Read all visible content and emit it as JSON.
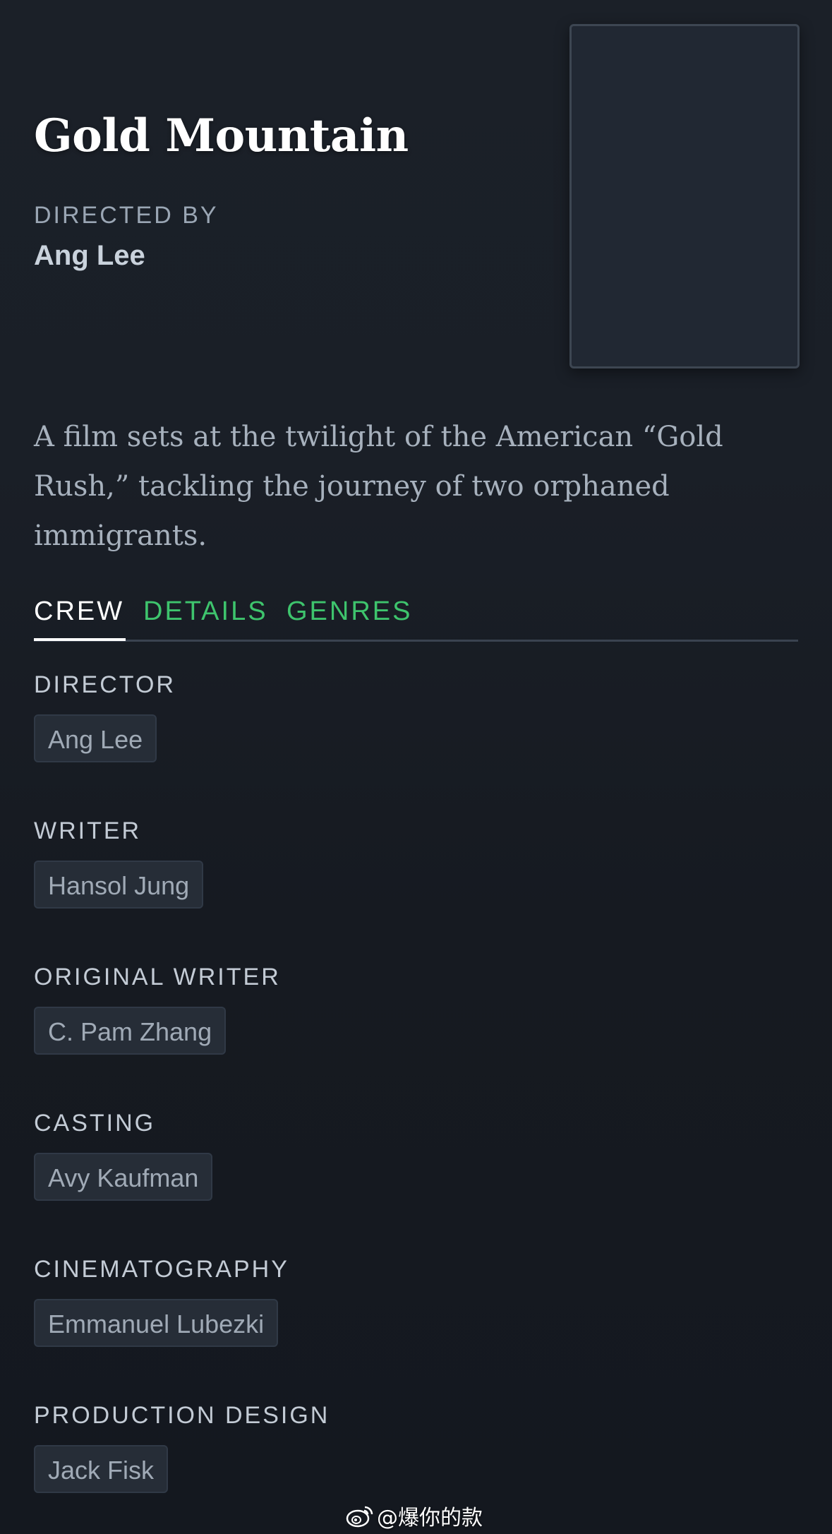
{
  "film": {
    "title": "Gold Mountain",
    "directed_by_label": "DIRECTED BY",
    "director": "Ang Lee",
    "synopsis": "A film sets at the twilight of the American “Gold Rush,” tackling the journey of two orphaned immigrants."
  },
  "tabs": [
    {
      "label": "CREW",
      "active": true
    },
    {
      "label": "DETAILS",
      "active": false
    },
    {
      "label": "GENRES",
      "active": false
    }
  ],
  "crew": [
    {
      "role": "DIRECTOR",
      "name": "Ang Lee"
    },
    {
      "role": "WRITER",
      "name": "Hansol Jung"
    },
    {
      "role": "ORIGINAL WRITER",
      "name": "C. Pam Zhang"
    },
    {
      "role": "CASTING",
      "name": "Avy Kaufman"
    },
    {
      "role": "CINEMATOGRAPHY",
      "name": "Emmanuel Lubezki"
    },
    {
      "role": "PRODUCTION DESIGN",
      "name": "Jack Fisk"
    }
  ],
  "watermark": {
    "text": "@爆你的款",
    "icon": "weibo-icon"
  },
  "colors": {
    "accent_green": "#3ec46d",
    "background": "#14181f",
    "chip": "#262d37"
  }
}
